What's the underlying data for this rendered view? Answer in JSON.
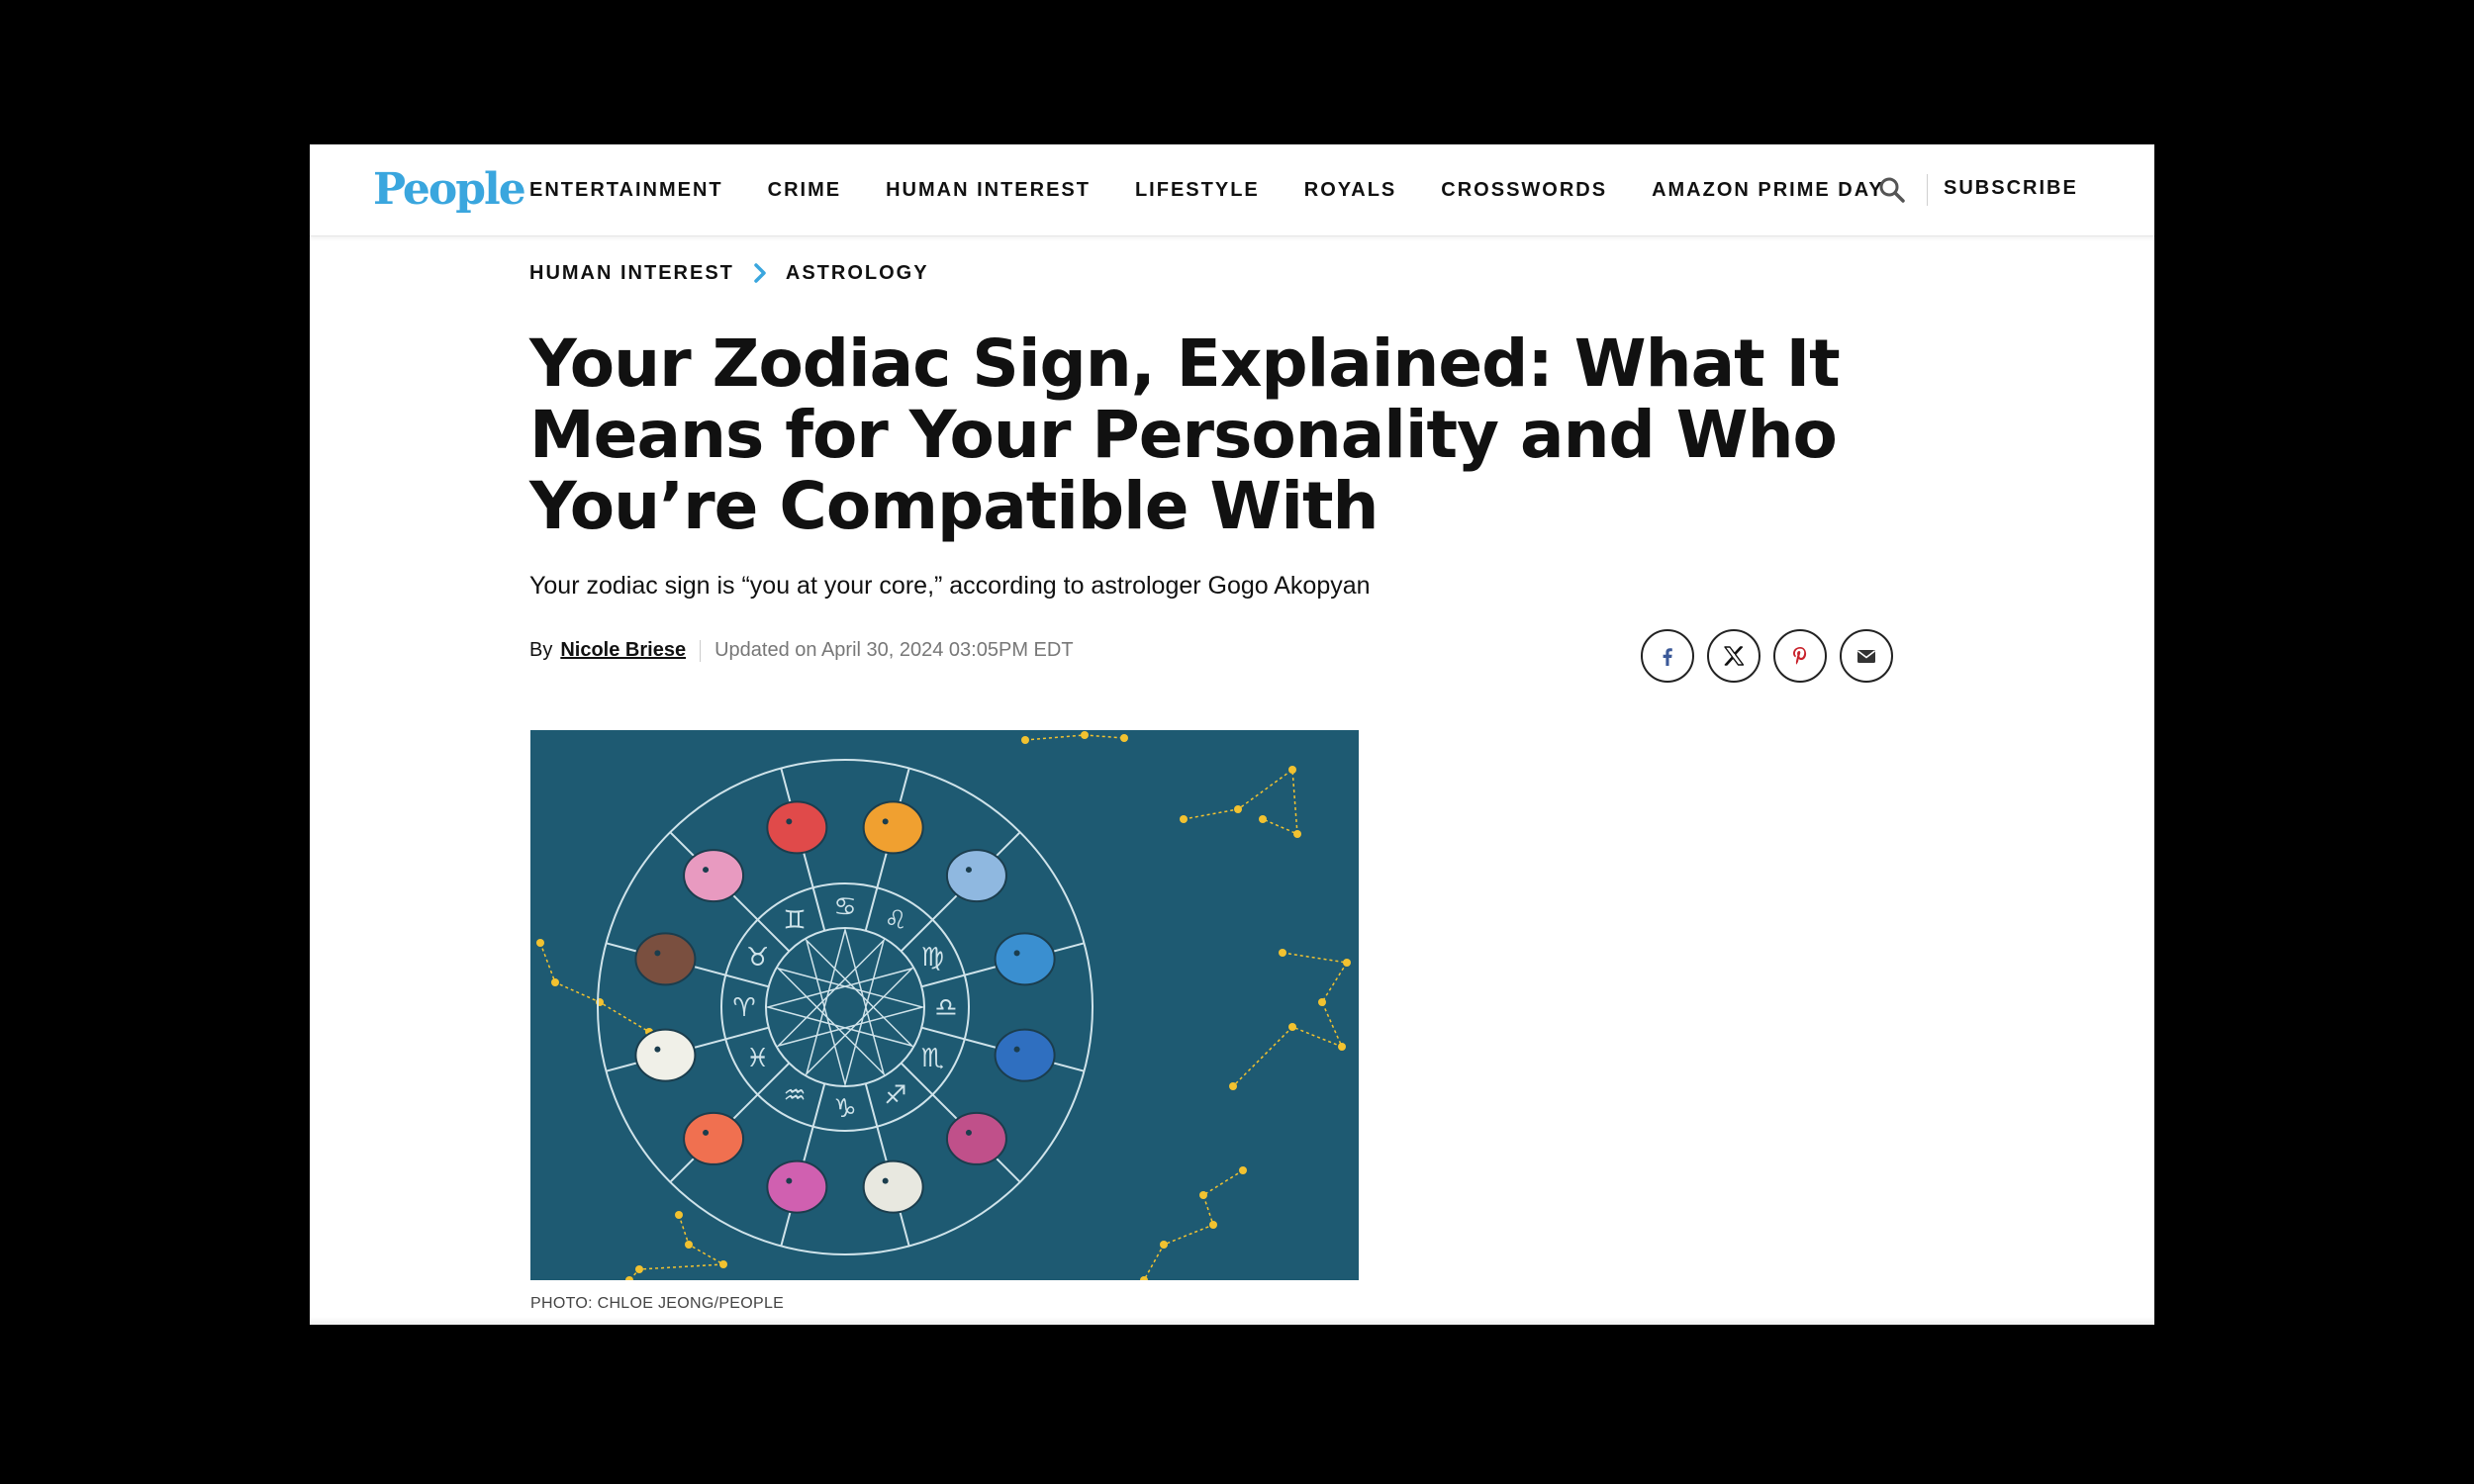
{
  "brand": {
    "logo_text": "People",
    "logo_color": "#3aa6de"
  },
  "nav": {
    "items": [
      {
        "label": "ENTERTAINMENT"
      },
      {
        "label": "CRIME"
      },
      {
        "label": "HUMAN INTEREST"
      },
      {
        "label": "LIFESTYLE"
      },
      {
        "label": "ROYALS"
      },
      {
        "label": "CROSSWORDS"
      },
      {
        "label": "AMAZON PRIME DAY"
      }
    ],
    "search_icon": "search-icon",
    "subscribe_label": "SUBSCRIBE"
  },
  "breadcrumb": {
    "items": [
      {
        "label": "HUMAN INTEREST"
      },
      {
        "label": "ASTROLOGY"
      }
    ],
    "separator_icon": "chevron-right-icon",
    "separator_color": "#3aa6de"
  },
  "article": {
    "headline": "Your Zodiac Sign, Explained: What It Means for Your Personality and Who You’re Compatible With",
    "dek": "Your zodiac sign is “you at your core,” according to astrologer Gogo Akopyan",
    "byline": {
      "by_label": "By",
      "author": "Nicole Briese",
      "updated": "Updated on April 30, 2024 03:05PM EDT"
    },
    "share": [
      {
        "network": "facebook",
        "icon": "facebook-icon",
        "color": "#3b5998"
      },
      {
        "network": "x",
        "icon": "x-icon",
        "color": "#111111"
      },
      {
        "network": "pinterest",
        "icon": "pinterest-icon",
        "color": "#c8232c"
      },
      {
        "network": "email",
        "icon": "email-icon",
        "color": "#333333"
      }
    ],
    "hero_image": {
      "background_color": "#1e5a72",
      "line_color": "#cfe3ea",
      "star_color": "#f2c230"
    },
    "caption": "PHOTO: CHLOE JEONG/PEOPLE"
  }
}
